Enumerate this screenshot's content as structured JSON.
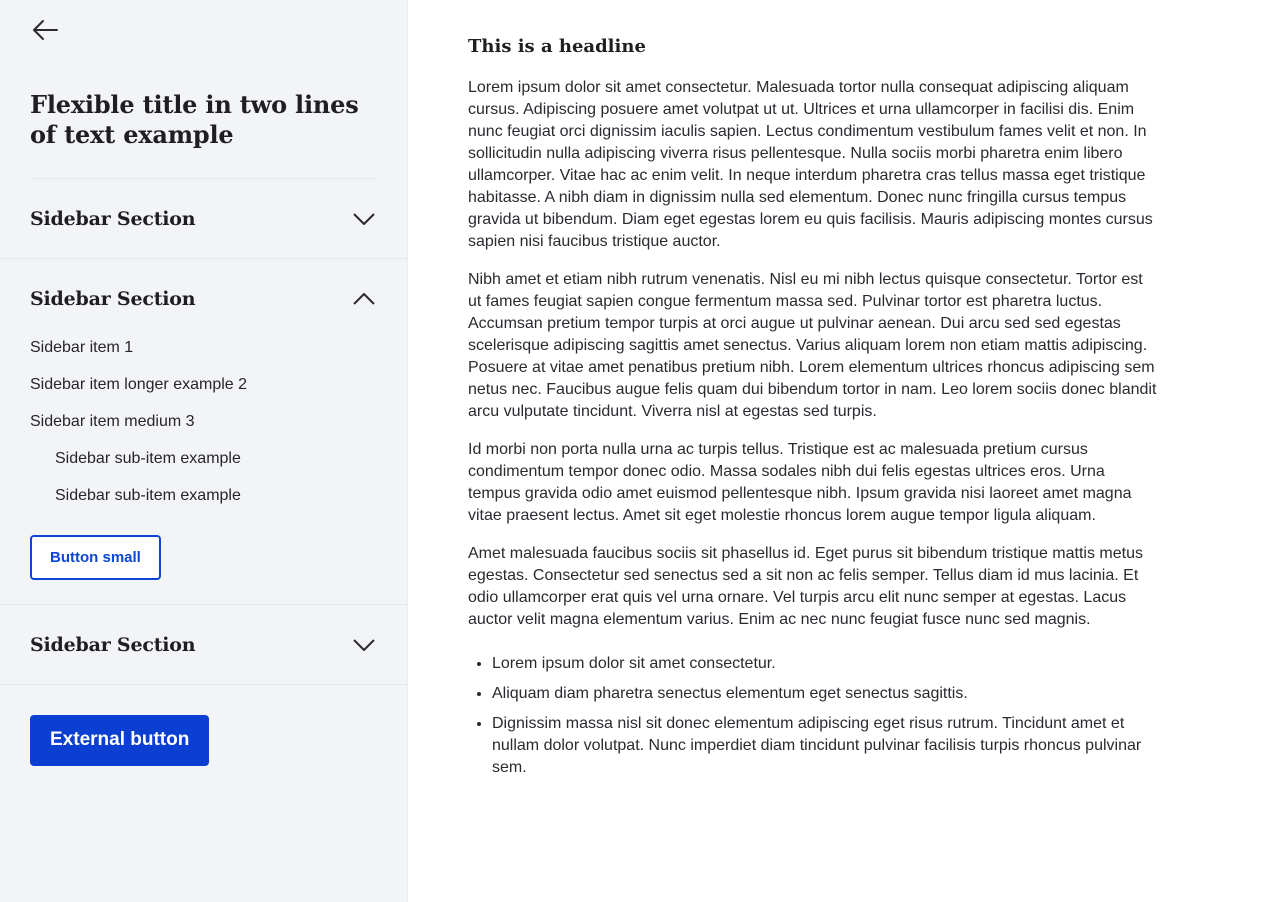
{
  "sidebar": {
    "back_icon": "arrow-left-icon",
    "title": "Flexible title in two lines of text example",
    "sections": [
      {
        "title": "Sidebar Section",
        "expanded": false,
        "chevron_icon": "chevron-down-icon"
      },
      {
        "title": "Sidebar Section",
        "expanded": true,
        "chevron_icon": "chevron-up-icon",
        "items": [
          "Sidebar item 1",
          "Sidebar item longer example 2",
          "Sidebar item medium 3"
        ],
        "subitems": [
          "Sidebar sub-item example",
          "Sidebar sub-item example"
        ],
        "button_label": "Button small"
      },
      {
        "title": "Sidebar Section",
        "expanded": false,
        "chevron_icon": "chevron-down-icon"
      }
    ],
    "external_button_label": "External button"
  },
  "main": {
    "headline": "This is a headline",
    "paragraphs": [
      "Lorem ipsum dolor sit amet consectetur. Malesuada tortor nulla consequat adipiscing aliquam cursus. Adipiscing posuere amet volutpat ut ut. Ultrices et urna ullamcorper in facilisi dis. Enim nunc feugiat orci dignissim iaculis sapien. Lectus condimentum vestibulum fames velit et non. In sollicitudin nulla adipiscing viverra risus pellentesque. Nulla sociis morbi pharetra enim libero ullamcorper. Vitae hac ac enim velit. In neque interdum pharetra cras tellus massa eget tristique habitasse. A nibh diam in dignissim nulla sed elementum. Donec nunc fringilla cursus tempus gravida ut bibendum. Diam eget egestas lorem eu quis facilisis. Mauris adipiscing montes cursus sapien nisi faucibus tristique auctor.",
      "Nibh amet et etiam nibh rutrum venenatis. Nisl eu mi nibh lectus quisque consectetur. Tortor est ut fames feugiat sapien congue fermentum massa sed. Pulvinar tortor est pharetra luctus. Accumsan pretium tempor turpis at orci augue ut pulvinar aenean. Dui arcu sed sed egestas scelerisque adipiscing sagittis amet senectus. Varius aliquam lorem non etiam mattis adipiscing. Posuere at vitae amet penatibus pretium nibh. Lorem elementum ultrices rhoncus adipiscing sem netus nec. Faucibus augue felis quam dui bibendum tortor in nam. Leo lorem sociis donec blandit arcu vulputate tincidunt. Viverra nisl at egestas sed turpis.",
      "Id morbi non porta nulla urna ac turpis tellus. Tristique est ac malesuada pretium cursus condimentum tempor donec odio. Massa sodales nibh dui felis egestas ultrices eros. Urna tempus gravida odio amet euismod pellentesque nibh. Ipsum gravida nisi laoreet amet magna vitae praesent lectus. Amet sit eget molestie rhoncus lorem augue tempor ligula aliquam.",
      "Amet malesuada faucibus sociis sit phasellus id. Eget purus sit bibendum tristique mattis metus egestas. Consectetur sed senectus sed a sit non ac felis semper. Tellus diam id mus lacinia. Et odio ullamcorper erat quis vel urna ornare. Vel turpis arcu elit nunc semper at egestas. Lacus auctor velit magna elementum varius. Enim ac nec nunc feugiat fusce nunc sed magnis."
    ],
    "bullets": [
      "Lorem ipsum dolor sit amet consectetur.",
      "Aliquam diam pharetra senectus elementum eget senectus sagittis.",
      "Dignissim massa nisl sit donec elementum adipiscing eget risus rutrum. Tincidunt amet et nullam dolor volutpat. Nunc imperdiet diam tincidunt pulvinar facilisis turpis rhoncus pulvinar sem."
    ]
  },
  "colors": {
    "sidebar_bg": "#f3f4f8",
    "primary": "#0b47d4",
    "text": "#1f1f23"
  }
}
